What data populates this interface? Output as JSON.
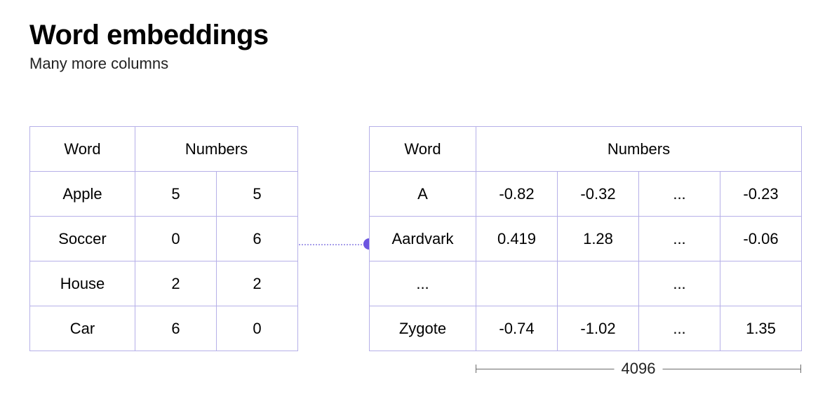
{
  "header": {
    "title": "Word embeddings",
    "subtitle": "Many more columns"
  },
  "left": {
    "col_word": "Word",
    "col_numbers": "Numbers",
    "rows": [
      {
        "word": "Apple",
        "v0": "5",
        "v1": "5"
      },
      {
        "word": "Soccer",
        "v0": "0",
        "v1": "6"
      },
      {
        "word": "House",
        "v0": "2",
        "v1": "2"
      },
      {
        "word": "Car",
        "v0": "6",
        "v1": "0"
      }
    ]
  },
  "right": {
    "col_word": "Word",
    "col_numbers": "Numbers",
    "rows": [
      {
        "word": "A",
        "v0": "-0.82",
        "v1": "-0.32",
        "v2": "...",
        "v3": "-0.23"
      },
      {
        "word": "Aardvark",
        "v0": "0.419",
        "v1": "1.28",
        "v2": "...",
        "v3": "-0.06"
      },
      {
        "word": "...",
        "v0": "",
        "v1": "",
        "v2": "...",
        "v3": ""
      },
      {
        "word": "Zygote",
        "v0": "-0.74",
        "v1": "-1.02",
        "v2": "...",
        "v3": "1.35"
      }
    ]
  },
  "dimension_label": "4096"
}
